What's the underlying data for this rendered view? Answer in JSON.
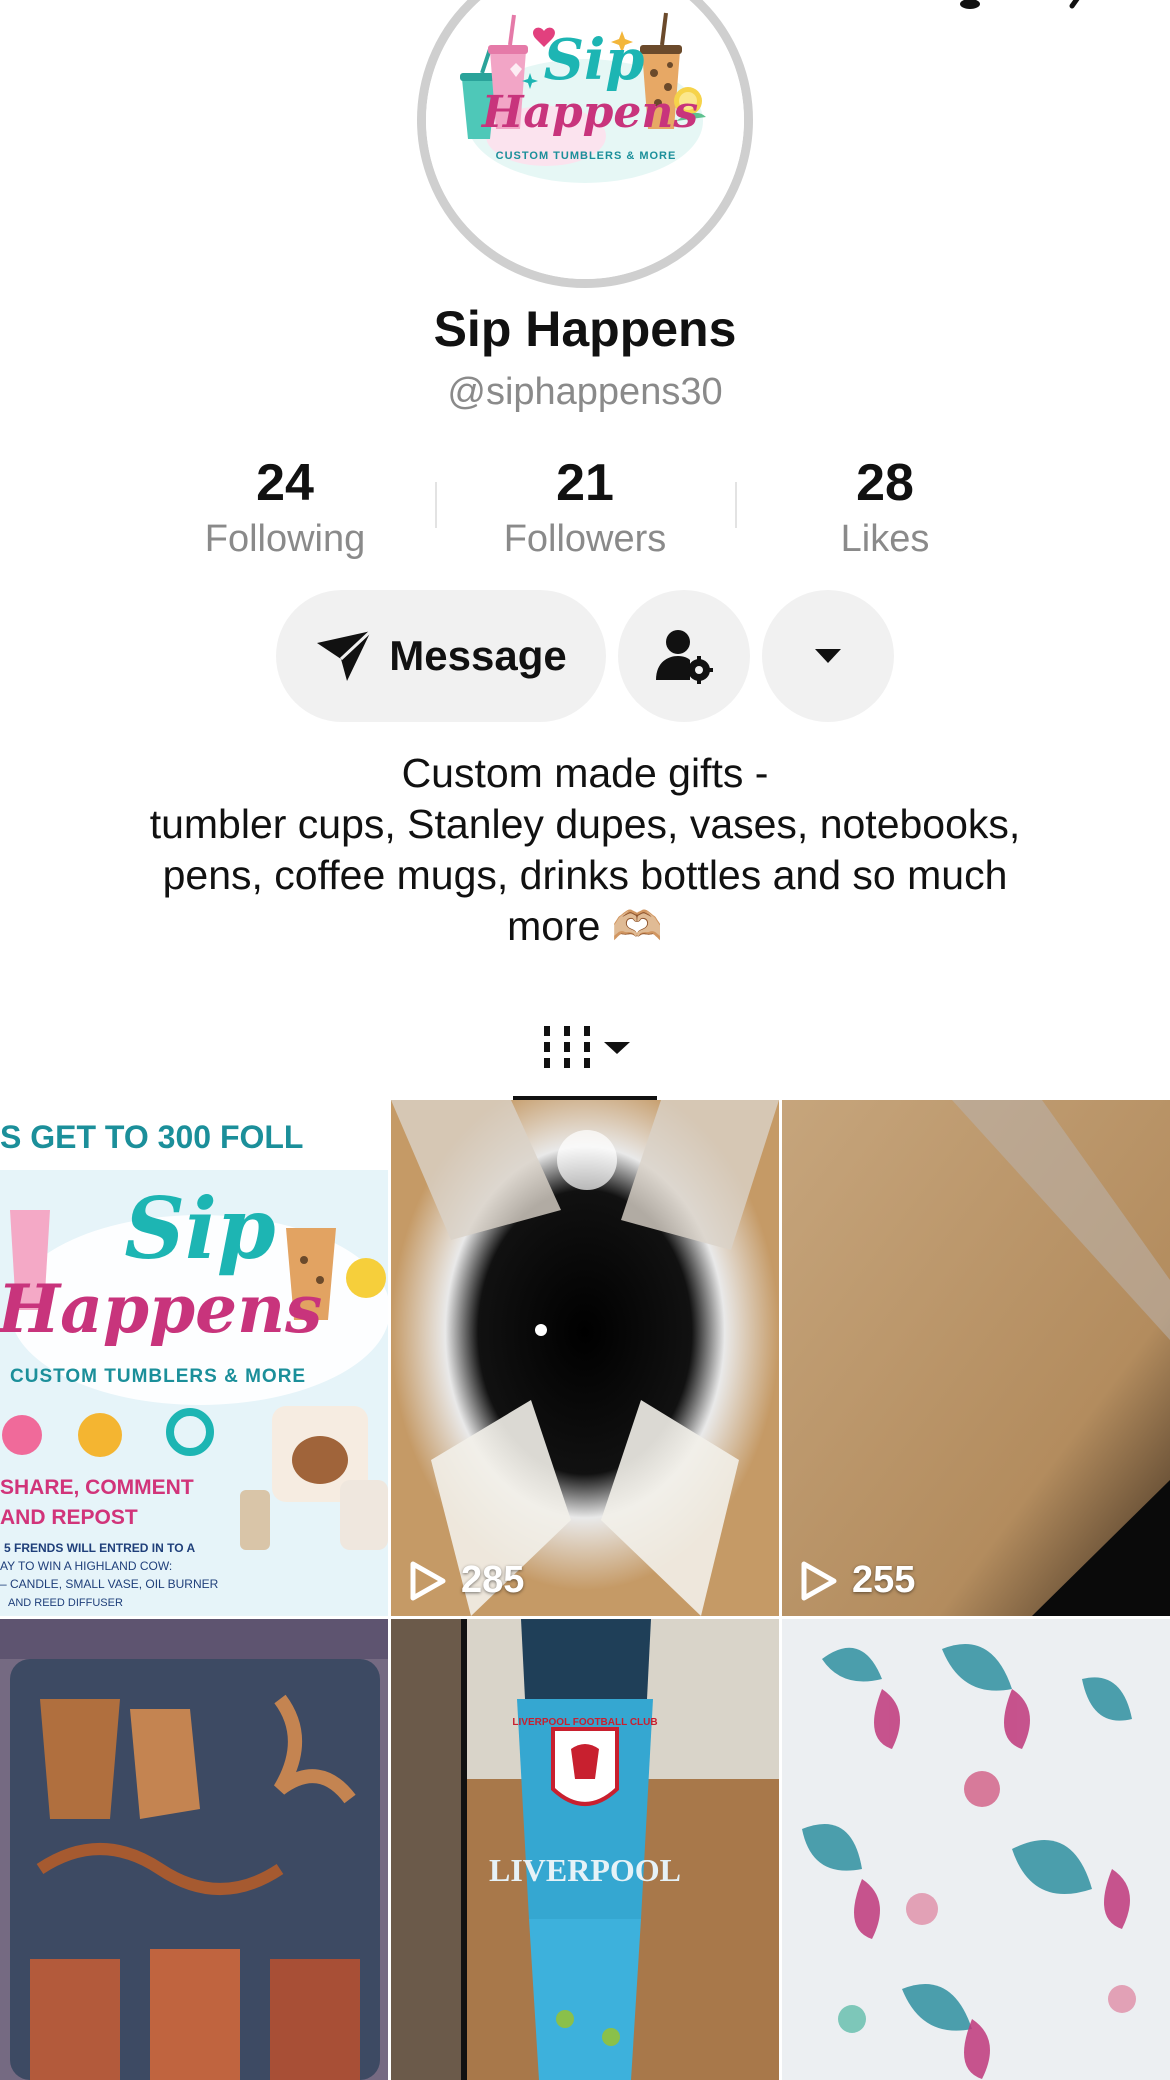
{
  "profile": {
    "logo": {
      "line1": "Sip",
      "line2": "Happens",
      "tagline": "CUSTOM TUMBLERS & MORE"
    },
    "display_name": "Sip Happens",
    "handle": "@siphappens30"
  },
  "stats": [
    {
      "value": "24",
      "label": "Following"
    },
    {
      "value": "21",
      "label": "Followers"
    },
    {
      "value": "28",
      "label": "Likes"
    }
  ],
  "actions": {
    "message_label": "Message",
    "icons": [
      "send-icon",
      "user-settings-icon",
      "dropdown-caret-icon"
    ]
  },
  "bio": {
    "lines": [
      "Custom made gifts -",
      "tumbler cups, Stanley dupes, vases, notebooks,",
      "pens, coffee mugs, drinks bottles and so much",
      "more 🫶🏼"
    ]
  },
  "tabs": {
    "active": "videos-grid",
    "icon": "grid-tab-icon"
  },
  "videos": [
    {
      "id": "post-1",
      "views": null,
      "text": {
        "headline": "S GET TO 300 FOLL",
        "logo1": "Sip",
        "logo2": "Happens",
        "tagline": "CUSTOM TUMBLERS & MORE",
        "cta1": "SHARE, COMMENT",
        "cta2": "AND REPOST",
        "fine1": "5 FRENDS WILL ENTRED IN TO A",
        "fine2": "AY TO WIN A HIGHLAND COW:",
        "fine3": "– CANDLE, SMALL VASE, OIL BURNER",
        "fine4": "AND REED DIFFUSER"
      }
    },
    {
      "id": "post-2",
      "views": "285"
    },
    {
      "id": "post-3",
      "views": "255"
    },
    {
      "id": "post-4",
      "views": null
    },
    {
      "id": "post-5",
      "views": null,
      "text": {
        "brand": "LIVERPOOL",
        "crest": "LIVERPOOL FOOTBALL CLUB"
      }
    },
    {
      "id": "post-6",
      "views": null
    }
  ],
  "colors": {
    "text_primary": "#111111",
    "text_secondary": "#8a8a8a",
    "button_bg": "#f1f1f1",
    "avatar_ring": "#cfcfcf",
    "logo_teal": "#1db5b3",
    "logo_pink": "#c8347c"
  }
}
